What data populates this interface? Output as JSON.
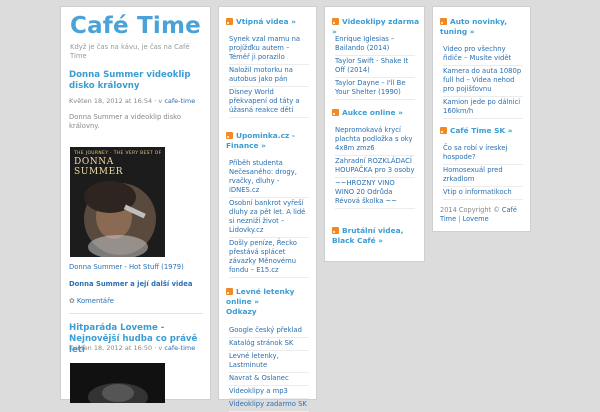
{
  "site": {
    "title": "Café Time",
    "tagline": "Když je čas na kávu, je čas na Café Time"
  },
  "posts": [
    {
      "title": "Donna Summer videoklip disko královny",
      "date": "Květen 18, 2012 at 16:54",
      "author_prefix": "· v",
      "author": "cafe-time",
      "excerpt": "Donna Summer a videoklip disko královny.",
      "cover_text_top": "THE JOURNEY · THE VERY BEST OF",
      "cover_text_name": "DONNA SUMMER",
      "song_link": "Donna Summer - Hot Stuff (1979)",
      "more_link": "Donna Summer a její další videa",
      "comments": "Komentáře"
    },
    {
      "title": "Hitparáda Loveme - Nejnovější hudba co právě letí",
      "date": "Květen 18, 2012 at 16:50",
      "author_prefix": "· v",
      "author": "cafe-time"
    }
  ],
  "widgets": {
    "vtipna": {
      "title": "Vtipná videa",
      "arrow": "»",
      "items": [
        "Synek vzal mamu na projížďku autem – Téměř ji porazilo",
        "Naložil motorku na autobus jako pán",
        "Disney World překvapení od táty a úžasná reakce dětí"
      ]
    },
    "upominka": {
      "title": "Upominka.cz - Finance",
      "arrow": "»",
      "items": [
        "Příběh studenta Nečesaného: drogy, rvačky, dluhy - iDNES.cz",
        "Osobní bankrot vyřeší dluhy za pět let. A lidé si nezniží život – Lidovky.cz",
        "Došly peníze, Řecko přestává splácet závazky Měnovému fondu – E15.cz"
      ]
    },
    "levne": {
      "title": "Levné letenky online",
      "arrow": "»",
      "title_line2": "Odkazy",
      "items": [
        "Google český překlad",
        "Katalóg stránok SK",
        "Levné letenky, Lastminute",
        "Navrat & Oslanec",
        "Videoklipy a mp3",
        "Videoklipy zadarmo SK"
      ]
    },
    "videoklipy": {
      "title": "Videoklipy zdarma",
      "arrow": "»",
      "items": [
        "Enrique Iglesias – Bailando (2014)",
        "Taylor Swift - Shake It Off (2014)",
        "Taylor Dayne – I'll Be Your Shelter (1990)"
      ]
    },
    "aukce": {
      "title": "Aukce online",
      "arrow": "»",
      "items": [
        "Nepromokavá krycí plachta podložka s oky 4x8m zmz6",
        "Zahradní ROZKLÁDACÍ HOUPAČKA pro 3 osoby",
        "~~HROZNY VINO WINO 20 Odrůda Révová školka ~~"
      ]
    },
    "brutalni": {
      "title": "Brutální videa, Black Café",
      "arrow": "»"
    },
    "auto": {
      "title": "Auto novinky, tuning",
      "arrow": "»",
      "items": [
        "Video pro všechny řidiče – Musíte vidět",
        "Kamera do auta 1080p full hd – Videa nehod pro pojišťovnu",
        "Kamion jede po dálnici 160km/h"
      ]
    },
    "cafesk": {
      "title": "Café Time SK",
      "arrow": "»",
      "items": [
        "Čo sa robí v íreskej hospode?",
        "Homosexuál pred zrkadlom",
        "Vtip o informatikoch"
      ]
    }
  },
  "footer": {
    "copyright": "2014 Copyright ©",
    "brand": "Café Time",
    "sep": "|",
    "link": "Loveme"
  }
}
